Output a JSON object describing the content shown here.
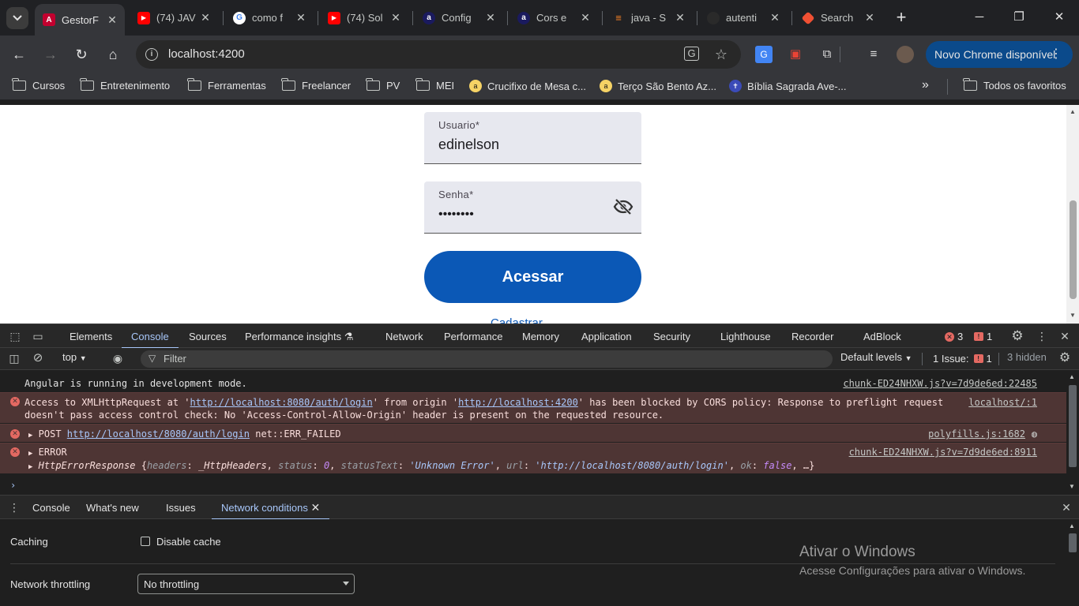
{
  "tabs": [
    {
      "title": "GestorF",
      "favicon": "angular-icon",
      "color": "#c3002f",
      "glyph": "A"
    },
    {
      "title": "(74) JAV",
      "favicon": "youtube-icon",
      "color": "#ff0000",
      "glyph": "▶"
    },
    {
      "title": "como f",
      "favicon": "google-icon",
      "color": "#ffffff",
      "glyph": "G"
    },
    {
      "title": "(74) Sol",
      "favicon": "youtube-icon",
      "color": "#ff0000",
      "glyph": "▶"
    },
    {
      "title": "Config",
      "favicon": "a-logo-icon",
      "color": "#1a1a5e",
      "glyph": "a"
    },
    {
      "title": "Cors e",
      "favicon": "a-logo-icon",
      "color": "#1a1a5e",
      "glyph": "a"
    },
    {
      "title": "java - S",
      "favicon": "stackoverflow-icon",
      "color": "#f48024",
      "glyph": "≡"
    },
    {
      "title": "autenti",
      "favicon": "github-icon",
      "color": "#2a2a2a",
      "glyph": "●"
    },
    {
      "title": "Search",
      "favicon": "git-icon",
      "color": "#f05033",
      "glyph": "◆"
    }
  ],
  "toolbar": {
    "url": "localhost:4200",
    "new_chrome_label": "Novo Chrome disponível"
  },
  "bookmarks": [
    {
      "label": "Cursos",
      "type": "folder"
    },
    {
      "label": "Entretenimento",
      "type": "folder"
    },
    {
      "label": "Ferramentas",
      "type": "folder"
    },
    {
      "label": "Freelancer",
      "type": "folder"
    },
    {
      "label": "PV",
      "type": "folder"
    },
    {
      "label": "MEI",
      "type": "folder"
    },
    {
      "label": "Crucifixo de Mesa c...",
      "type": "site"
    },
    {
      "label": "Terço São Bento Az...",
      "type": "site"
    },
    {
      "label": "Bíblia Sagrada Ave-...",
      "type": "site"
    },
    {
      "label": "Todos os favoritos",
      "type": "folder"
    }
  ],
  "login": {
    "user_label": "Usuario*",
    "user_value": "edinelson",
    "password_label": "Senha*",
    "password_value": "••••••••",
    "submit_label": "Acessar",
    "link_peek": "Cadastrar"
  },
  "devtools": {
    "tabs": [
      "Elements",
      "Console",
      "Sources",
      "Performance insights",
      "Network",
      "Performance",
      "Memory",
      "Application",
      "Security",
      "Lighthouse",
      "Recorder",
      "AdBlock"
    ],
    "active_tab": "Console",
    "error_count": "3",
    "warning_count": "1",
    "context": "top",
    "filter_placeholder": "Filter",
    "levels": "Default levels",
    "issues_label": "1 Issue:",
    "issues_count": "1",
    "hidden_label": "3 hidden",
    "console": {
      "info_msg": "Angular is running in development mode.",
      "info_src": "chunk-ED24NHXW.js?v=7d9de6ed:22485",
      "cors_part1": "Access to XMLHttpRequest at '",
      "cors_url1": "http://localhost:8080/auth/login",
      "cors_part2": "' from origin '",
      "cors_url2": "http://localhost:4200",
      "cors_part3": "' has been blocked by CORS policy: Response to preflight request",
      "cors_line2": "doesn't pass access control check: No 'Access-Control-Allow-Origin' header is present on the requested resource.",
      "cors_src": "localhost/:1",
      "post_prefix": "POST",
      "post_url": "http://localhost/8080/auth/login",
      "post_suffix": "net::ERR_FAILED",
      "post_src": "polyfills.js:1682",
      "error_label": "ERROR",
      "error_src": "chunk-ED24NHXW.js?v=7d9de6ed:8911",
      "resp_name": "HttpErrorResponse",
      "resp_k_headers": "headers",
      "resp_v_headers": "_HttpHeaders",
      "resp_k_status": "status",
      "resp_v_status": "0",
      "resp_k_statustext": "statusText",
      "resp_v_statustext": "'Unknown Error'",
      "resp_k_url": "url",
      "resp_v_url": "'http://localhost/8080/auth/login'",
      "resp_k_ok": "ok",
      "resp_v_ok": "false",
      "resp_tail": "…}"
    },
    "drawer_tabs": [
      "Console",
      "What's new",
      "Issues",
      "Network conditions"
    ],
    "drawer_active": "Network conditions",
    "caching_label": "Caching",
    "disable_cache_label": "Disable cache",
    "throttling_label": "Network throttling",
    "throttling_value": "No throttling"
  },
  "watermark": {
    "title": "Ativar o Windows",
    "subtitle": "Acesse Configurações para ativar o Windows."
  }
}
